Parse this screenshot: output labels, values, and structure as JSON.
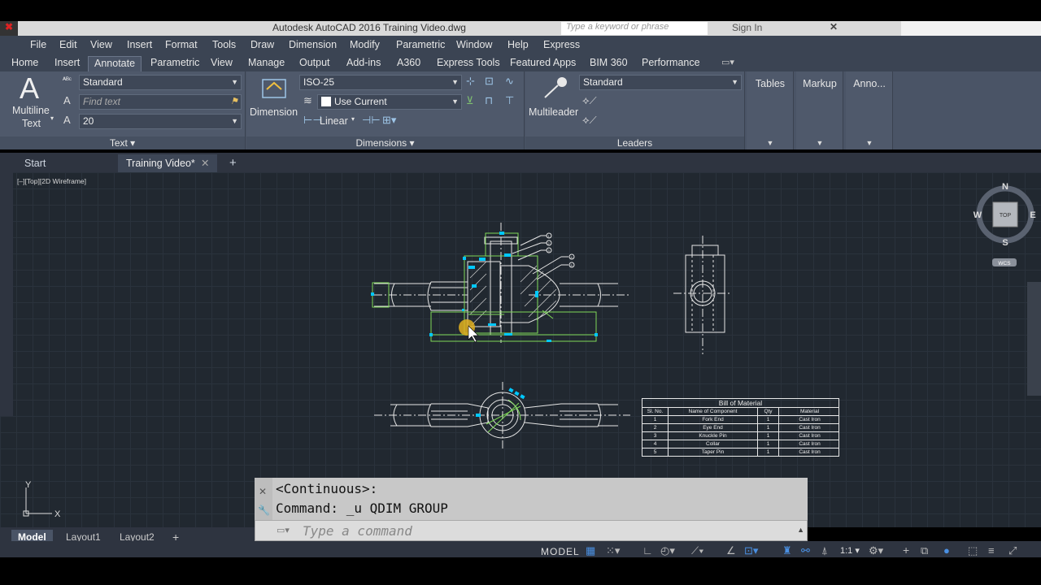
{
  "titlebar": {
    "title": "Autodesk AutoCAD 2016    Training Video.dwg",
    "search_placeholder": "Type a keyword or phrase",
    "sign_in": "Sign In"
  },
  "menu": [
    "File",
    "Edit",
    "View",
    "Insert",
    "Format",
    "Tools",
    "Draw",
    "Dimension",
    "Modify",
    "Parametric",
    "Window",
    "Help",
    "Express"
  ],
  "ribbon_tabs": [
    "Home",
    "Insert",
    "Annotate",
    "Parametric",
    "View",
    "Manage",
    "Output",
    "Add-ins",
    "A360",
    "Express Tools",
    "Featured Apps",
    "BIM 360",
    "Performance"
  ],
  "active_tab": "Annotate",
  "text_panel": {
    "multiline_label_1": "Multiline",
    "multiline_label_2": "Text",
    "style": "Standard",
    "find_placeholder": "Find text",
    "height": "20",
    "footer": "Text"
  },
  "dimensions_panel": {
    "button_label": "Dimension",
    "style": "ISO-25",
    "layer": "Use Current",
    "linear": "Linear",
    "footer": "Dimensions"
  },
  "leaders_panel": {
    "button_label": "Multileader",
    "style": "Standard",
    "footer": "Leaders"
  },
  "side_panels": [
    "Tables",
    "Markup",
    "Anno..."
  ],
  "file_tabs": [
    "Start",
    "Training Video*"
  ],
  "view_label": "[–][Top][2D Wireframe]",
  "viewcube": {
    "n": "N",
    "s": "S",
    "e": "E",
    "w": "W",
    "top": "TOP",
    "wcs": "WCS"
  },
  "ucs": {
    "x": "X",
    "y": "Y"
  },
  "bom": {
    "title": "Bill of Material",
    "headers": [
      "Sl. No.",
      "Name of Component",
      "Qty",
      "Material"
    ],
    "rows": [
      [
        "1",
        "Fork End",
        "1",
        "Cast Iron"
      ],
      [
        "2",
        "Eye End",
        "1",
        "Cast Iron"
      ],
      [
        "3",
        "Knuckle Pin",
        "1",
        "Cast Iron"
      ],
      [
        "4",
        "Collar",
        "1",
        "Cast Iron"
      ],
      [
        "5",
        "Taper Pin",
        "1",
        "Cast Iron"
      ]
    ]
  },
  "command": {
    "history_1": "<Continuous>:",
    "history_2": "Command:  _u QDIM GROUP",
    "placeholder": "Type a command"
  },
  "layout_tabs": [
    "Model",
    "Layout1",
    "Layout2"
  ],
  "status": {
    "model": "MODEL",
    "scale": "1:1"
  },
  "balloons": [
    "1",
    "2",
    "3",
    "4",
    "5"
  ]
}
